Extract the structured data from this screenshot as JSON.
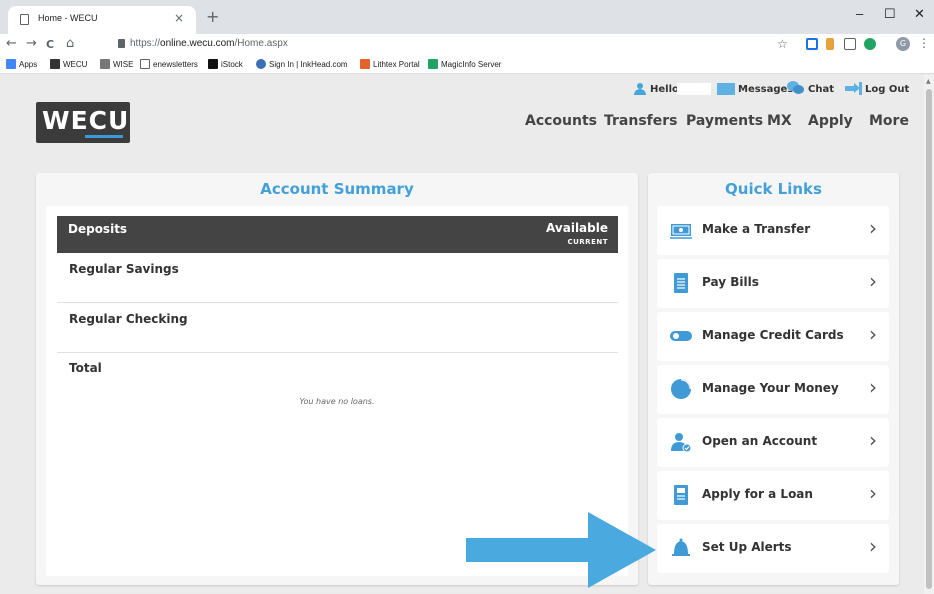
{
  "browser": {
    "tab_title": "Home - WECU",
    "tab_close": "×",
    "new_tab": "+",
    "window_controls": [
      "–",
      "☐",
      "✕"
    ],
    "nav": {
      "back": "←",
      "forward": "→",
      "reload": "C",
      "home": "⌂"
    },
    "url_prefix": "https://",
    "url_host": "online.wecu.com",
    "url_path": "/Home.aspx",
    "star": "☆",
    "profile_letter": "G",
    "menu": "⋮",
    "bookmarks": [
      "Apps",
      "WECU",
      "WISE",
      "enewsletters",
      "iStock",
      "Sign In | InkHead.com",
      "Lithtex Portal",
      "MagicInfo Server"
    ]
  },
  "header": {
    "logo_text": "WECU",
    "hello": "Hello",
    "messages": "Messages",
    "chat": "Chat",
    "logout": "Log Out",
    "nav": [
      "Accounts",
      "Transfers",
      "Payments",
      "MX",
      "Apply",
      "More"
    ]
  },
  "summary": {
    "title": "Account Summary",
    "deposits_label": "Deposits",
    "available_label": "Available",
    "current_label": "CURRENT",
    "accounts": [
      "Regular Savings",
      "Regular Checking",
      "Total"
    ],
    "no_loans": "You have no loans."
  },
  "quick_links": {
    "title": "Quick Links",
    "chevron": "›",
    "items": [
      {
        "label": "Make a Transfer",
        "icon": "transfer-icon"
      },
      {
        "label": "Pay Bills",
        "icon": "bill-icon"
      },
      {
        "label": "Manage Credit Cards",
        "icon": "toggle-card-icon"
      },
      {
        "label": "Manage Your Money",
        "icon": "pie-chart-icon"
      },
      {
        "label": "Open an Account",
        "icon": "add-person-icon"
      },
      {
        "label": "Apply for a Loan",
        "icon": "loan-document-icon"
      },
      {
        "label": "Set Up Alerts",
        "icon": "bell-icon"
      }
    ]
  },
  "colors": {
    "accent": "#43a0d9",
    "arrow": "#4aa9de",
    "dark": "#444444"
  }
}
